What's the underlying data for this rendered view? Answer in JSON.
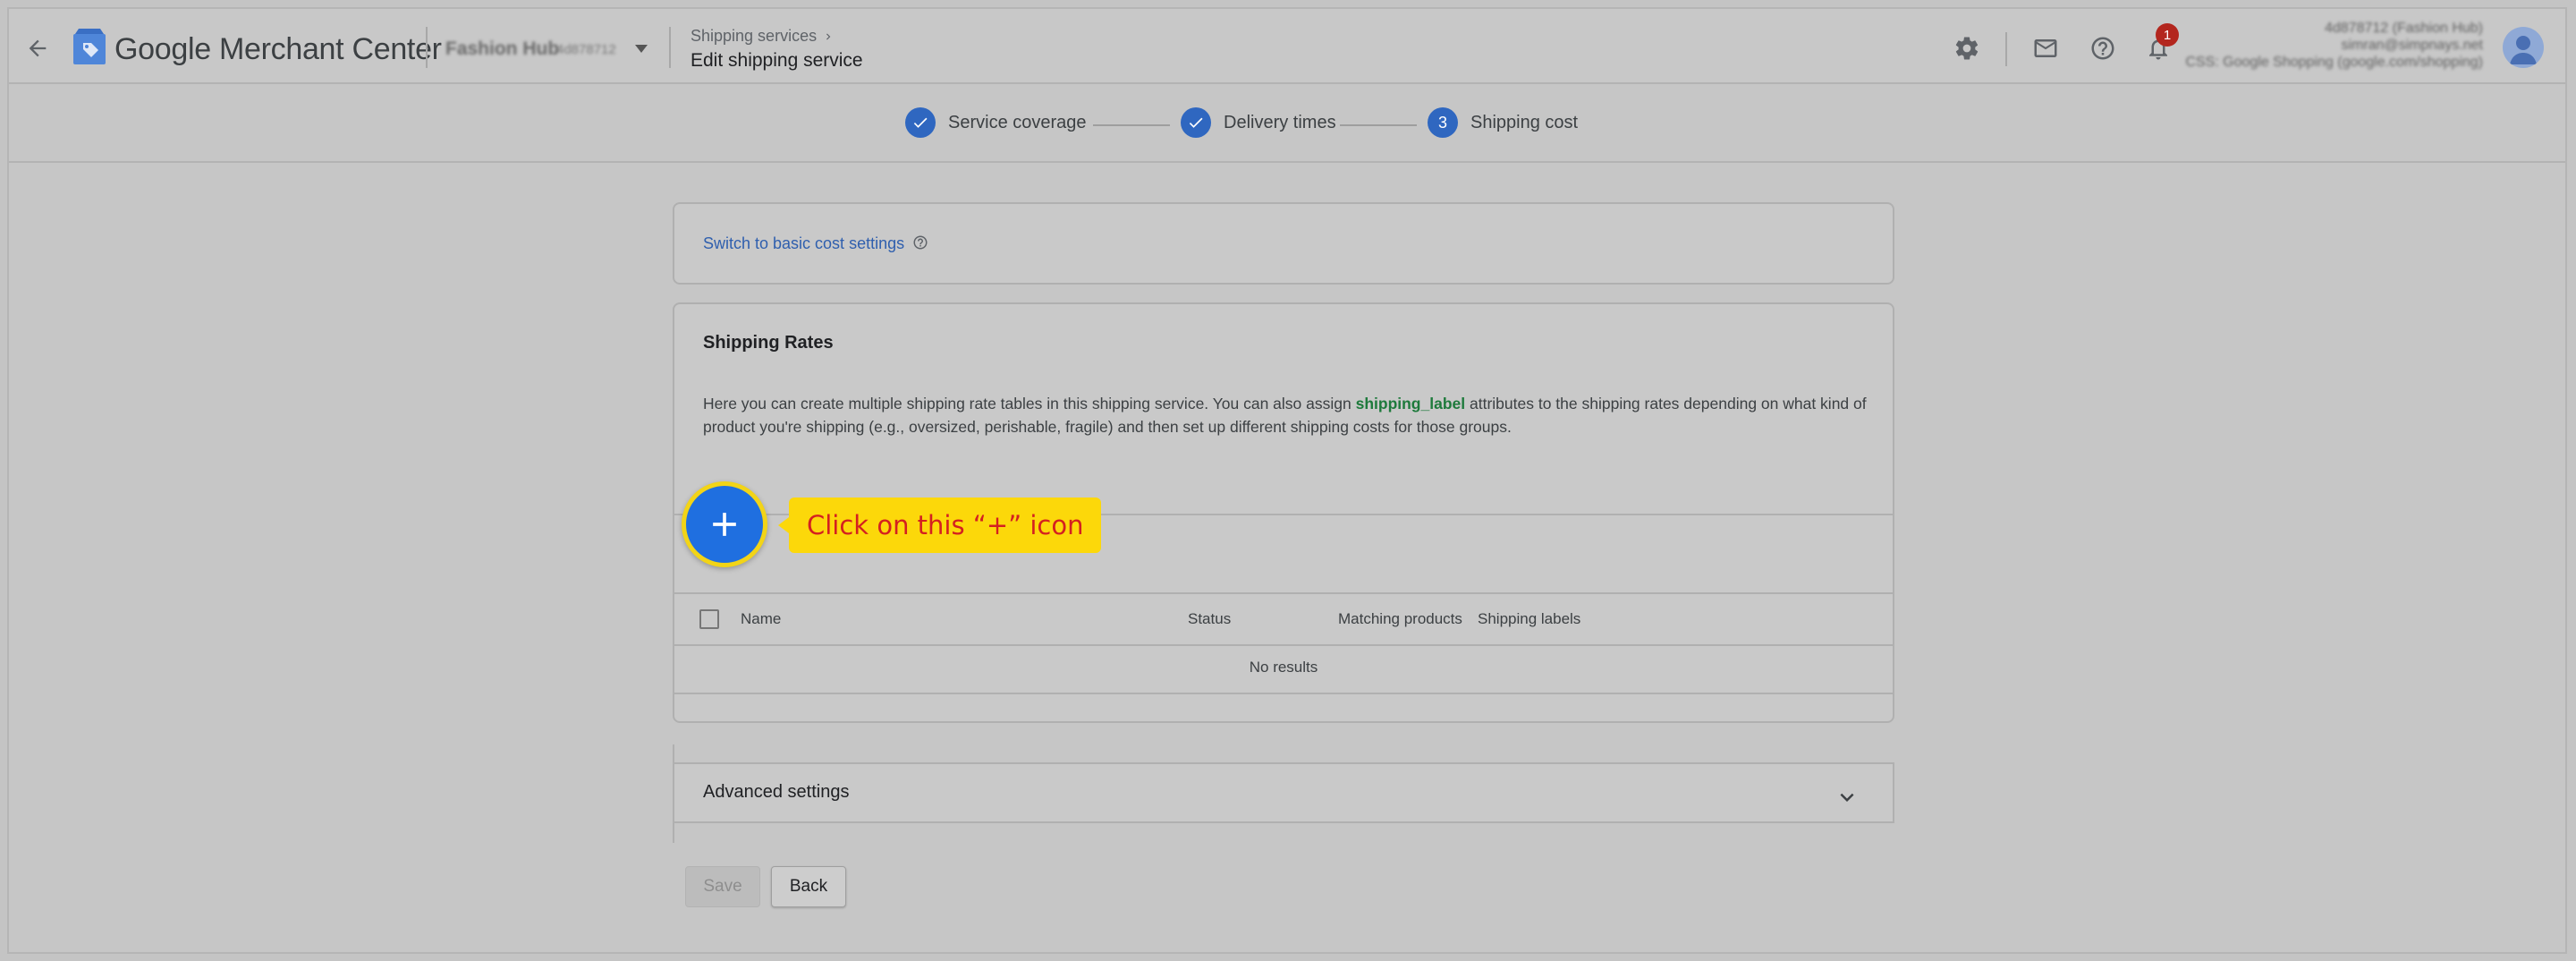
{
  "header": {
    "logo_text": "Google Merchant Center",
    "account_name": "Fashion Hub",
    "account_id": "4d878712",
    "breadcrumb": "Shipping services",
    "page_title": "Edit shipping service",
    "notification_count": "1",
    "user_lines": [
      "4d878712 (Fashion Hub)",
      "simran@simpnays.net",
      "CSS: Google Shopping (google.com/shopping)"
    ]
  },
  "stepper": {
    "steps": [
      {
        "label": "Service coverage",
        "state": "done"
      },
      {
        "label": "Delivery times",
        "state": "done"
      },
      {
        "number": "3",
        "label": "Shipping cost",
        "state": "current"
      }
    ]
  },
  "basic_settings_link": "Switch to basic cost settings",
  "shipping_rates": {
    "title": "Shipping Rates",
    "desc_before": "Here you can create multiple shipping rate tables in this shipping service. You can also assign ",
    "desc_keyword": "shipping_label",
    "desc_after": " attributes to the shipping rates depending on what kind of product you're shipping (e.g., oversized, perishable, fragile) and then set up different shipping costs for those groups.",
    "columns": {
      "name": "Name",
      "status": "Status",
      "matching": "Matching products",
      "labels": "Shipping labels"
    },
    "empty_text": "No results"
  },
  "callout": {
    "text": "Click on this “+” icon"
  },
  "advanced_settings": {
    "title": "Advanced settings"
  },
  "buttons": {
    "save": "Save",
    "back": "Back"
  },
  "colors": {
    "primary": "#2f67c0",
    "fab": "#1f6fe0",
    "callout_bg": "#fcd80a",
    "callout_text": "#d42020",
    "badge": "#b3261e",
    "keyword": "#1e7a3c"
  }
}
